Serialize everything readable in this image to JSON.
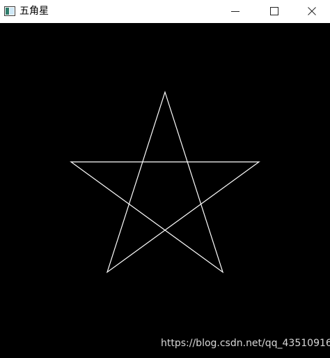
{
  "window": {
    "title": "五角星",
    "icon": "app-window-icon",
    "controls": {
      "minimize": "minimize-icon",
      "maximize": "maximize-icon",
      "close": "close-icon"
    }
  },
  "canvas": {
    "background": "#000000",
    "stroke": "#ffffff",
    "shape": "pentagram"
  },
  "watermark": "https://blog.csdn.net/qq_43510916"
}
